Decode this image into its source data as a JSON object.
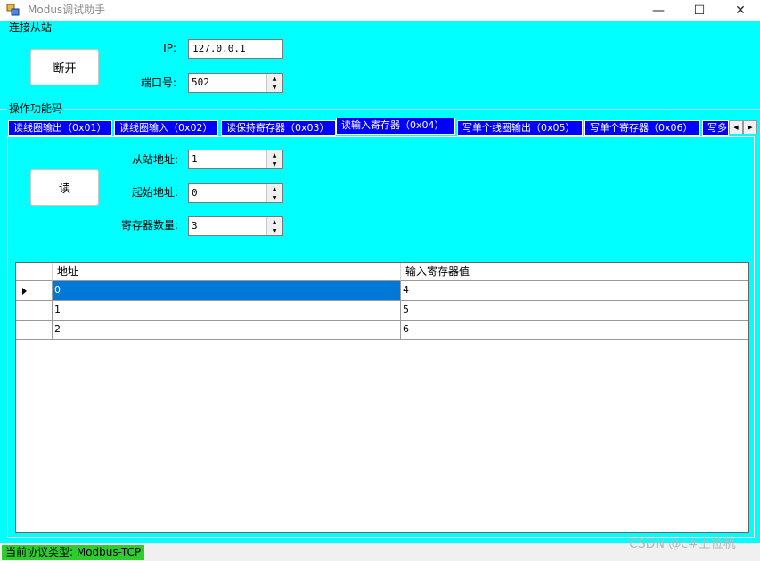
{
  "window": {
    "title": "Modus调试助手",
    "minimize_glyph": "—",
    "maximize_glyph": "☐",
    "close_glyph": "✕"
  },
  "connect_group": {
    "title": "连接从站",
    "button_label": "断开",
    "ip_label": "IP:",
    "ip_value": "127.0.0.1",
    "port_label": "端口号:",
    "port_value": "502"
  },
  "function_group": {
    "title": "操作功能码"
  },
  "tabs": [
    {
      "label": "读线圈输出（0x01）"
    },
    {
      "label": "读线圈输入（0x02）"
    },
    {
      "label": "读保持寄存器（0x03）"
    },
    {
      "label": "读输入寄存器（0x04）"
    },
    {
      "label": "写单个线圈输出（0x05）"
    },
    {
      "label": "写单个寄存器（0x06）"
    },
    {
      "label": "写多"
    }
  ],
  "read_panel": {
    "button_label": "读",
    "slave_label": "从站地址:",
    "slave_value": "1",
    "start_label": "起始地址:",
    "start_value": "0",
    "count_label": "寄存器数量:",
    "count_value": "3"
  },
  "grid": {
    "columns": [
      "地址",
      "输入寄存器值"
    ],
    "rows": [
      {
        "address": "0",
        "value": "4"
      },
      {
        "address": "1",
        "value": "5"
      },
      {
        "address": "2",
        "value": "6"
      }
    ]
  },
  "status": {
    "text": "当前协议类型: Modbus-TCP"
  },
  "watermark": "CSDN @c#上位机",
  "colors": {
    "client_bg": "#00ffff",
    "tab_bg": "#0000ff",
    "selection": "#0078d7",
    "status_badge": "#2fcc2f"
  }
}
